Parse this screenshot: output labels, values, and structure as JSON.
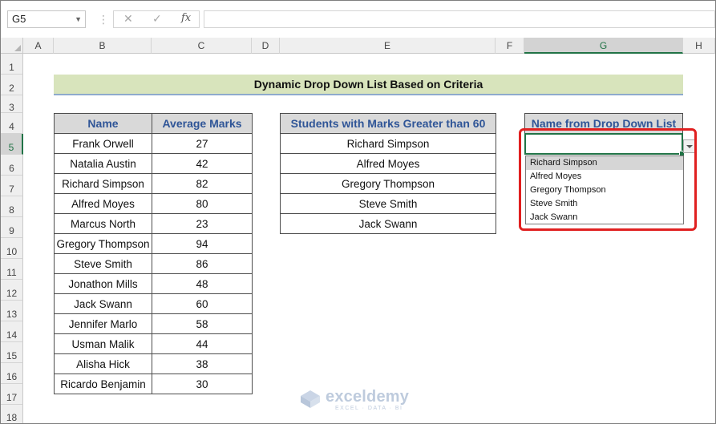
{
  "namebox": {
    "value": "G5"
  },
  "formula_bar": {
    "cancel": "✕",
    "enter": "✓",
    "fx": "fx",
    "content": ""
  },
  "columns": [
    "A",
    "B",
    "C",
    "D",
    "E",
    "F",
    "G",
    "H"
  ],
  "rows": [
    "1",
    "2",
    "3",
    "4",
    "5",
    "6",
    "7",
    "8",
    "9",
    "10",
    "11",
    "12",
    "13",
    "14",
    "15",
    "16",
    "17",
    "18"
  ],
  "title": "Dynamic Drop Down List Based on Criteria",
  "table1": {
    "headers": [
      "Name",
      "Average Marks"
    ],
    "rows": [
      [
        "Frank Orwell",
        "27"
      ],
      [
        "Natalia Austin",
        "42"
      ],
      [
        "Richard Simpson",
        "82"
      ],
      [
        "Alfred Moyes",
        "80"
      ],
      [
        "Marcus North",
        "23"
      ],
      [
        "Gregory Thompson",
        "94"
      ],
      [
        "Steve Smith",
        "86"
      ],
      [
        "Jonathon Mills",
        "48"
      ],
      [
        "Jack Swann",
        "60"
      ],
      [
        "Jennifer Marlo",
        "58"
      ],
      [
        "Usman Malik",
        "44"
      ],
      [
        "Alisha Hick",
        "38"
      ],
      [
        "Ricardo Benjamin",
        "30"
      ]
    ]
  },
  "table2": {
    "header": "Students with Marks Greater than 60",
    "rows": [
      "Richard Simpson",
      "Alfred Moyes",
      "Gregory Thompson",
      "Steve Smith",
      "Jack Swann"
    ]
  },
  "dropdown": {
    "header": "Name from Drop Down List",
    "selected_cell_value": "",
    "options": [
      "Richard Simpson",
      "Alfred Moyes",
      "Gregory Thompson",
      "Steve Smith",
      "Jack Swann"
    ],
    "highlighted_index": 0
  },
  "watermark": {
    "brand": "exceldemy",
    "tagline": "EXCEL · DATA · BI"
  },
  "colors": {
    "accent_green": "#217346",
    "highlight_red": "#e02020",
    "header_blue": "#2f5597",
    "banner_green": "#d8e4bc"
  }
}
